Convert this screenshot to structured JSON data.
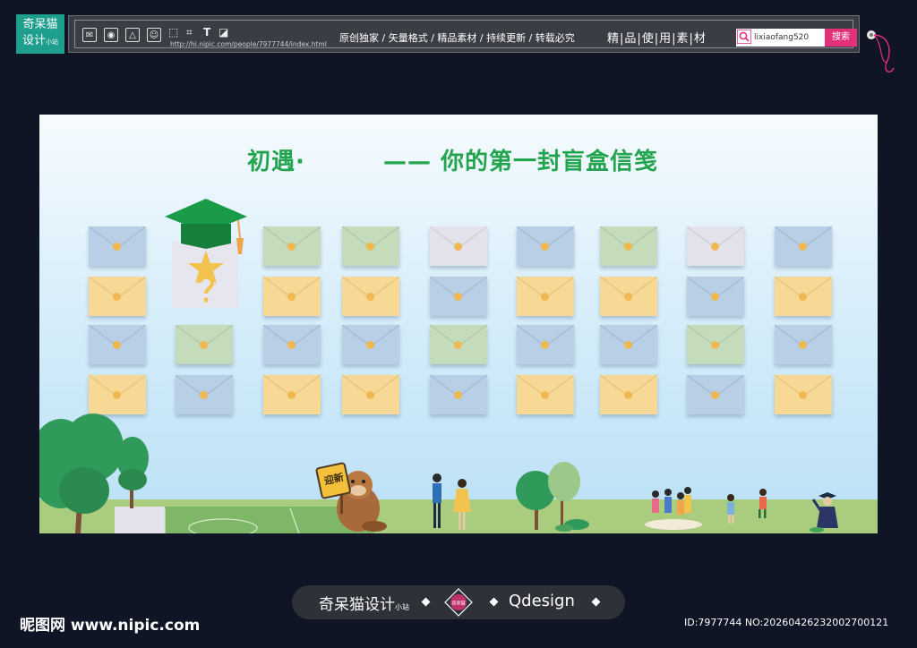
{
  "topbar": {
    "logo_line1": "奇呆猫",
    "logo_line2": "设计",
    "logo_small": "小站",
    "url": "http://hi.nipic.com/people/7977744/index.html",
    "slogan": "原创独家 / 矢量格式 / 精品素材 / 持续更新 / 转载必究",
    "chars": "精|品|使|用|素|材",
    "search_value": "lixiaofang520",
    "search_button": "搜索",
    "accent": "#e3307a"
  },
  "poster": {
    "title_left": "初遇·",
    "title_right": "—— 你的第一封盲盒信笺",
    "badge": "迎新",
    "title_color": "#23a44e",
    "envelope_colors": {
      "blue": "#b8cfe6",
      "green": "#c4dcbc",
      "yellow": "#f7d995",
      "grey": "#e3e1ea"
    }
  },
  "footer": {
    "brand": "奇呆猫设计",
    "brand_small": "小站",
    "emblem_text": "奇呆猫",
    "qdesign": "Qdesign",
    "watermark_left": "昵图网 www.nipic.com",
    "watermark_right": "ID:7977744 NO:20260426232002700121"
  }
}
